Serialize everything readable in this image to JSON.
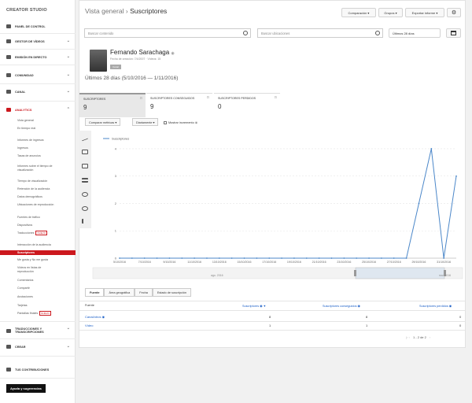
{
  "sidebar": {
    "brand": "CREATOR STUDIO",
    "items": [
      {
        "label": "PANEL DE CONTROL",
        "icon": "dashboard-icon"
      },
      {
        "label": "GESTOR DE VÍDEOS",
        "icon": "video-manager-icon"
      },
      {
        "label": "EMISIÓN EN DIRECTO",
        "icon": "live-icon"
      },
      {
        "label": "COMUNIDAD",
        "icon": "community-icon"
      },
      {
        "label": "CANAL",
        "icon": "channel-icon"
      },
      {
        "label": "ANALYTICS",
        "icon": "analytics-icon"
      }
    ],
    "analytics_sub": [
      "Vista general",
      "En tiempo real",
      "Informes de ingresos",
      "Ingresos",
      "Tasas de anuncios",
      "Informes sobre el tiempo de visualización",
      "Tiempo de visualización",
      "Retención de la audiencia",
      "Datos demográficos",
      "Ubicaciones de reproducción",
      "Fuentes de tráfico",
      "Dispositivos",
      "Traducciones",
      "Interacción de la audiencia",
      "Suscriptores",
      "Me gusta y No me gusta",
      "Vídeos en listas de reproducción",
      "Comentarios",
      "Compartir",
      "Anotaciones",
      "Tarjetas",
      "Pantallas finales"
    ],
    "badge_new": "NUEVO",
    "bottom_items": [
      {
        "label": "TRADUCCIONES Y TRANSCRIPCIONES",
        "icon": "translate-icon"
      },
      {
        "label": "CREAR",
        "icon": "create-icon"
      },
      {
        "label": "TUS CONTRIBUCIONES",
        "icon": "contributions-icon"
      }
    ],
    "help_button": "Ayuda y sugerencias"
  },
  "header": {
    "breadcrumb_parent": "Vista general",
    "breadcrumb_sep": "›",
    "breadcrumb_current": "Suscriptores",
    "compare_btn": "Comparación ▾",
    "groups_btn": "Grupos ▾",
    "export_btn": "Exportar informe ▾",
    "settings_icon": "gear-icon"
  },
  "filters": {
    "content_placeholder": "Buscar contenido",
    "location_placeholder": "Buscar ubicaciones",
    "date_range": "Últimos 28 días",
    "calendar_icon": "calendar-icon"
  },
  "profile": {
    "name": "Fernando Sarachaga",
    "meta": "Fecha de creación: 7/4/2007 · Vídeos: 15",
    "tag": "Canal",
    "range_text": "Últimos 28 días (5/10/2016 — 1/11/2016)"
  },
  "metrics": [
    {
      "label": "SUSCRIPTORES",
      "value": "9"
    },
    {
      "label": "SUSCRIPTORES CONSEGUIDOS",
      "value": "9"
    },
    {
      "label": "SUSCRIPTORES PERDIDOS",
      "value": "0"
    }
  ],
  "chart_controls": {
    "compare": "Comparar métricas ▾",
    "per_day": "Diariamente ▾",
    "show_growth": "Mostrar incremento"
  },
  "chart_data": {
    "type": "line",
    "legend": "Suscriptores",
    "x": [
      "5/10/2016",
      "6/10/2016",
      "7/10/2016",
      "8/10/2016",
      "9/10/2016",
      "10/10/2016",
      "11/10/2016",
      "12/10/2016",
      "13/10/2016",
      "14/10/2016",
      "15/10/2016",
      "16/10/2016",
      "17/10/2016",
      "18/10/2016",
      "19/10/2016",
      "20/10/2016",
      "21/10/2016",
      "22/10/2016",
      "23/10/2016",
      "24/10/2016",
      "25/10/2016",
      "26/10/2016",
      "27/10/2016",
      "28/10/2016",
      "29/10/2016",
      "30/10/2016",
      "31/10/2016",
      "1/11/2016"
    ],
    "values": [
      0,
      0,
      0,
      0,
      0,
      0,
      0,
      0,
      0,
      0,
      0,
      0,
      0,
      0,
      0,
      0,
      0,
      0,
      0,
      0,
      0,
      0,
      0,
      0,
      2,
      4,
      0,
      3
    ],
    "x_tick_labels": [
      "5/10/2016",
      "7/10/2016",
      "9/10/2016",
      "11/10/2016",
      "13/10/2016",
      "15/10/2016",
      "17/10/2016",
      "19/10/2016",
      "21/10/2016",
      "23/10/2016",
      "25/10/2016",
      "27/10/2016",
      "29/10/2016",
      "31/10/2016"
    ],
    "y_ticks": [
      0,
      1,
      2,
      3,
      4
    ],
    "ylim": [
      0,
      4.2
    ],
    "color": "#4b87c9",
    "nav_labels": [
      "ago. 2016",
      "nov. 2016"
    ]
  },
  "table": {
    "tabs": [
      "Fuente",
      "Área geográfica",
      "Fecha",
      "Estado de suscripción"
    ],
    "headers": [
      "Fuente",
      "Suscriptores",
      "Suscriptores conseguidos",
      "Suscriptores perdidos"
    ],
    "rows": [
      {
        "source": "Canal/otros",
        "subs": "8",
        "gained": "8",
        "lost": "0"
      },
      {
        "source": "Vídeo",
        "subs": "1",
        "gained": "1",
        "lost": "0"
      }
    ],
    "pager": "1 - 2 de 2"
  }
}
